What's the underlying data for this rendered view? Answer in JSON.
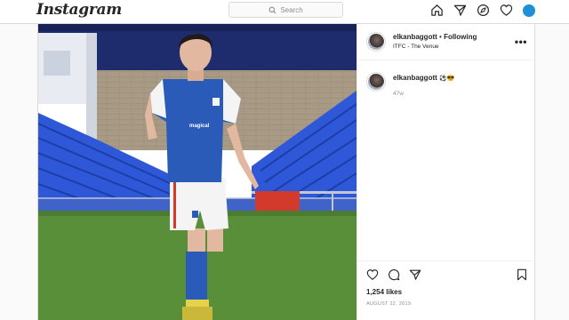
{
  "app": {
    "logo": "Instagram"
  },
  "search": {
    "placeholder": "Search"
  },
  "nav": {
    "icons": [
      "home-icon",
      "direct-icon",
      "explore-icon",
      "activity-icon",
      "profile-avatar"
    ]
  },
  "post": {
    "username": "elkanbaggott",
    "separator": "•",
    "follow_status": "Following",
    "location": "ITFC - The Venue",
    "more_label": "•••",
    "caption": {
      "username": "elkanbaggott",
      "emoji": "⚽😎"
    },
    "time_ago": "47w",
    "likes": "1,254 likes",
    "date": "AUGUST 22, 2019"
  },
  "colors": {
    "accent": "#1f8fd6",
    "kit_blue": "#2a5bb8",
    "pitch": "#5a8f3a",
    "seats": "#2f58d8"
  }
}
